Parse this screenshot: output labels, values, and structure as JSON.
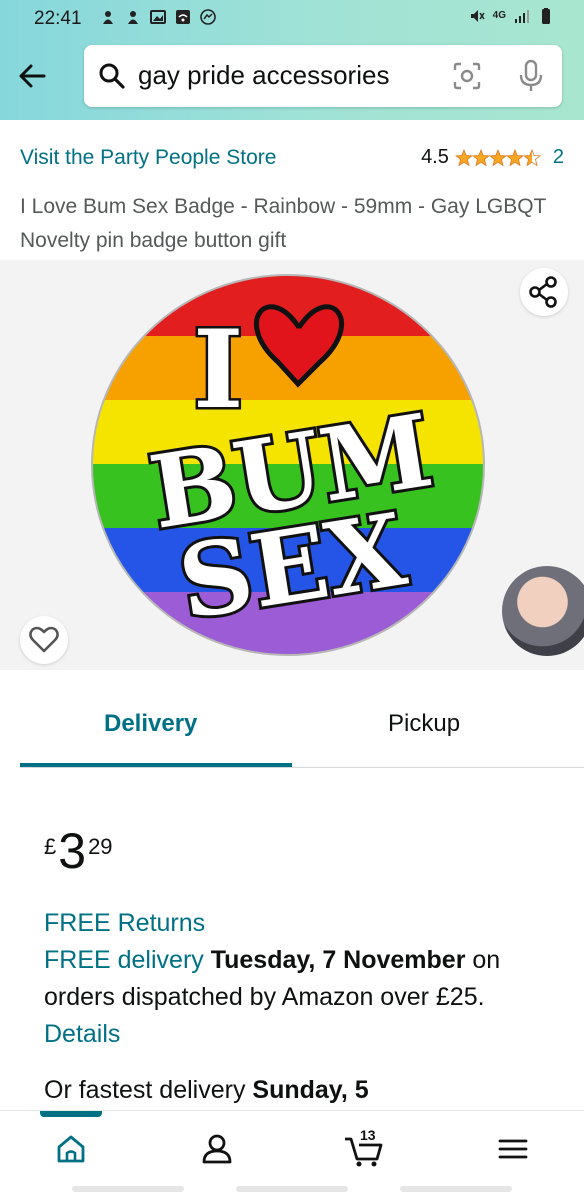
{
  "status_bar": {
    "time": "22:41",
    "network": "4G"
  },
  "search": {
    "query": "gay pride accessories",
    "icons": [
      "back-arrow-icon",
      "search-icon",
      "camera-scan-icon",
      "microphone-icon"
    ]
  },
  "product": {
    "store_link": "Visit the Party People Store",
    "rating_value": "4.5",
    "rating_stars": 4.5,
    "rating_count": "2",
    "title": "I Love Bum Sex Badge - Rainbow - 59mm - Gay LGBQT Novelty pin badge button gift",
    "badge_text": {
      "line1": "I",
      "line2": "BUM",
      "line3": "SEX"
    },
    "badge_colors": [
      "#e21e1e",
      "#f6a100",
      "#f5e400",
      "#37c21f",
      "#2455e6",
      "#9b5cd6"
    ]
  },
  "tabs": {
    "delivery": "Delivery",
    "pickup": "Pickup",
    "active": "Delivery"
  },
  "price": {
    "currency": "£",
    "whole": "3",
    "fraction": "29"
  },
  "delivery": {
    "free_returns": "FREE Returns",
    "free_delivery": "FREE delivery",
    "date": "Tuesday, 7 November",
    "on": "on",
    "condition": "orders dispatched by Amazon over £25.",
    "details": "Details",
    "fastest_prefix": "Or fastest delivery",
    "fastest_date": "Sunday, 5"
  },
  "bottom_nav": {
    "items": [
      "home-icon",
      "account-icon",
      "cart-icon",
      "menu-icon"
    ],
    "cart_count": "13"
  },
  "colors": {
    "link": "#007185",
    "star": "#f7a723"
  }
}
